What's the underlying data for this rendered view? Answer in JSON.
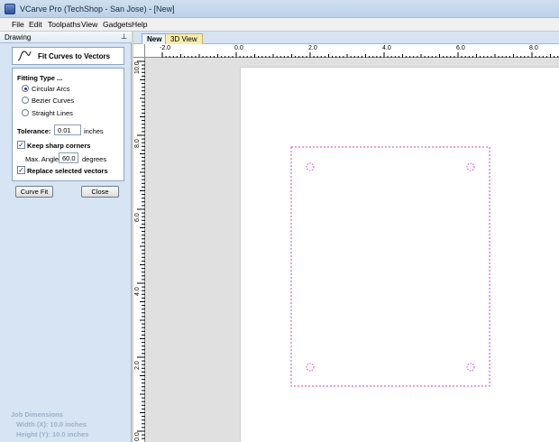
{
  "window": {
    "title": "VCarve Pro (TechShop - San Jose) - [New]"
  },
  "menu": {
    "items": [
      "File",
      "Edit",
      "Toolpaths",
      "View",
      "Gadgets",
      "Help"
    ]
  },
  "panel": {
    "header": "Drawing",
    "pin_glyph": "⊥",
    "tool_name": "Fit Curves to Vectors",
    "fitting_type_label": "Fitting Type ...",
    "options": [
      {
        "label": "Circular Arcs",
        "selected": true
      },
      {
        "label": "Bezier Curves",
        "selected": false
      },
      {
        "label": "Straight Lines",
        "selected": false
      }
    ],
    "tolerance_label": "Tolerance:",
    "tolerance_value": "0.01",
    "tolerance_units": "inches",
    "keep_corners_label": "Keep sharp corners",
    "keep_corners_checked": true,
    "max_angle_label": "Max. Angle",
    "max_angle_value": "60.0",
    "max_angle_units": "degrees",
    "replace_label": "Replace selected vectors",
    "replace_checked": true,
    "curve_fit_button": "Curve Fit",
    "close_button": "Close"
  },
  "job": {
    "heading": "Job Dimensions",
    "width": "Width  (X): 10.0 inches",
    "height": "Height (Y): 10.0 inches"
  },
  "tabs": {
    "new": "New",
    "view3d": "3D View"
  },
  "ruler": {
    "top_labels": [
      "-2.0",
      "0.0",
      "2.0",
      "4.0",
      "6.0",
      "8.0"
    ],
    "left_labels": [
      "10.0",
      "8.0",
      "6.0",
      "4.0",
      "2.0",
      "0.0"
    ]
  },
  "colors": {
    "selection": "#d23fd2",
    "panel_bg": "#d6e4f3"
  }
}
